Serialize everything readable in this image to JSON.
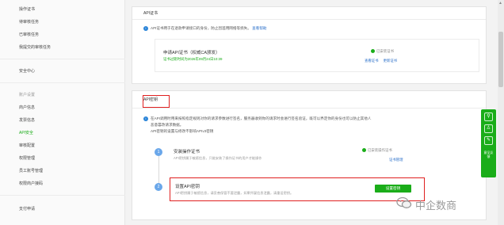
{
  "sidebar": {
    "items_top": [
      {
        "label": "操作证书"
      },
      {
        "label": "待审核任务"
      },
      {
        "label": "已审核任务"
      },
      {
        "label": "我提交的审核任务"
      }
    ],
    "security_center": "安全中心",
    "account_section": "账户设置",
    "account_items": [
      {
        "label": "商户信息"
      },
      {
        "label": "发票信息"
      },
      {
        "label": "API安全"
      },
      {
        "label": "审核配置"
      },
      {
        "label": "权限管理"
      },
      {
        "label": "员工账号管理"
      },
      {
        "label": "权限商户接码"
      }
    ],
    "bottom_item": "支付申请"
  },
  "cert_panel": {
    "title": "API证书",
    "notice": "API证书用于在退款申请接口的身份，防止因滥用网络等损失。",
    "notice_link": "查看帮助",
    "box_title": "申请API证书（权威CA颁发）",
    "box_sub": "证书过期时间为2026年09月24日10:39",
    "status": "已安装证书",
    "links": [
      "查看证书",
      "更新证书"
    ]
  },
  "key_panel": {
    "tab": "API密钥",
    "notice_line1": "在API调用时用来按照指定规则对你的请求参数进行签名，服务器收到你的请求时会进行签名验证，既可以界定你的身份也可以防止其他人",
    "notice_line2": "恶意篡改请求数据。",
    "notice_line3": "API密钥的设置与修改不影响APIv3密钥",
    "step1": {
      "num": "1",
      "title": "安装操作证书",
      "desc": "API密钥属于敏感信息，只能安装了操作证书的用户才能操作",
      "status": "已安装操作证书",
      "link": "证书管理"
    },
    "step2": {
      "num": "2",
      "title": "设置API密钥",
      "desc": "API密钥属于敏感信息，请妥善保管不要泄露，如果怀疑信息泄露，请重设密钥。",
      "button": "设置密钥"
    }
  },
  "floatbar": {
    "icons": [
      "link-icon",
      "user-icon",
      "edit-icon"
    ],
    "text": "意见反馈"
  },
  "watermark": {
    "text": "中企数商"
  },
  "colors": {
    "accent_green": "#1aad19",
    "highlight_red": "#e02020",
    "link_blue": "#2a6fc9"
  }
}
